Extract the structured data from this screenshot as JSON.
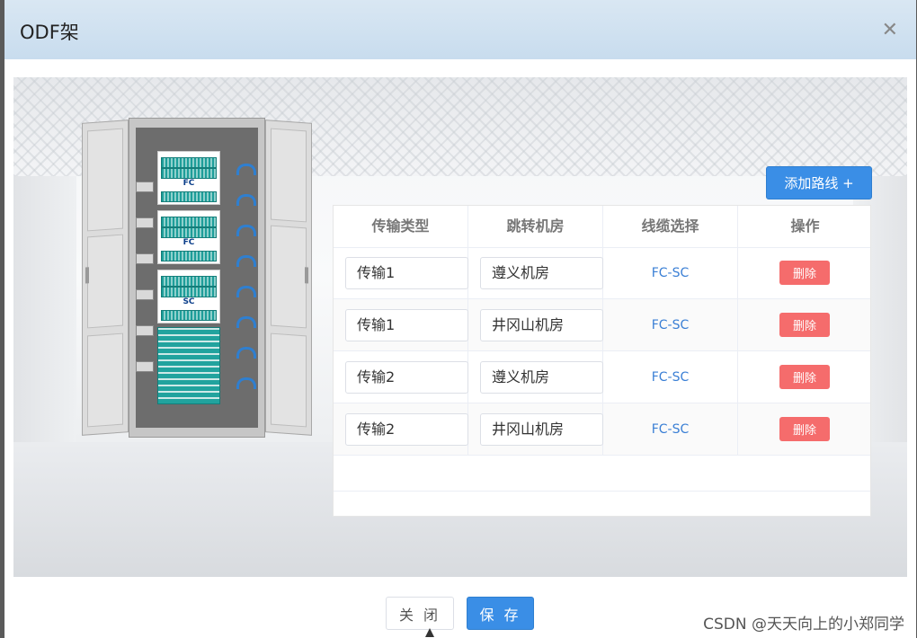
{
  "dialog": {
    "title": "ODF架",
    "close_icon": "close-icon"
  },
  "cabinet": {
    "labels": [
      "FC",
      "FC",
      "SC"
    ]
  },
  "routes": {
    "add_label": "添加路线 +",
    "headers": [
      "传输类型",
      "跳转机房",
      "线缆选择",
      "操作"
    ],
    "rows": [
      {
        "type": "传输1",
        "room": "遵义机房",
        "cable": "FC-SC",
        "action": "删除"
      },
      {
        "type": "传输1",
        "room": "井冈山机房",
        "cable": "FC-SC",
        "action": "删除"
      },
      {
        "type": "传输2",
        "room": "遵义机房",
        "cable": "FC-SC",
        "action": "删除"
      },
      {
        "type": "传输2",
        "room": "井冈山机房",
        "cable": "FC-SC",
        "action": "删除"
      }
    ]
  },
  "footer": {
    "close_label": "关 闭",
    "save_label": "保 存"
  },
  "watermark": "CSDN @天天向上的小郑同学",
  "colors": {
    "primary": "#3a8ee6",
    "danger": "#f56c6c",
    "header_bg": "#d9e7f3",
    "link": "#3a7fd5"
  }
}
